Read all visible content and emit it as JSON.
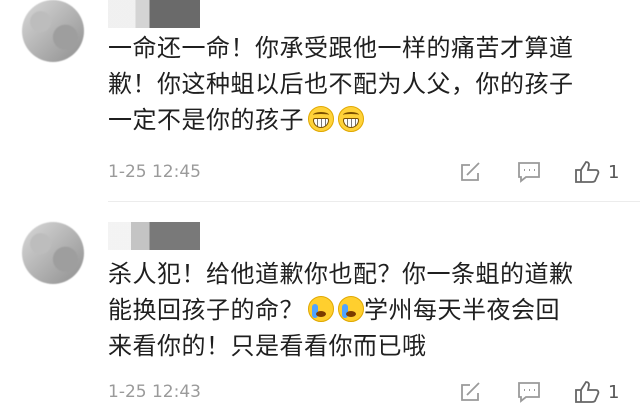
{
  "comments": [
    {
      "lines": [
        "一命还一命！你承受跟他一样的痛苦才算道",
        "歉！你这种蛆以后也不配为人父，你的孩子",
        "一定不是你的孩子"
      ],
      "time": "1-25 12:45",
      "likes": "1",
      "emojis": [
        "grin-icon",
        "grin-icon"
      ]
    },
    {
      "lines": [
        "杀人犯！给他道歉你也配？你一条蛆的道歉",
        "能换回孩子的命？",
        "学州每天半夜会回",
        "来看你的！只是看看你而已哦"
      ],
      "time": "1-25 12:43",
      "likes": "1",
      "emojis": [
        "crying-icon",
        "crying-icon"
      ]
    }
  ]
}
